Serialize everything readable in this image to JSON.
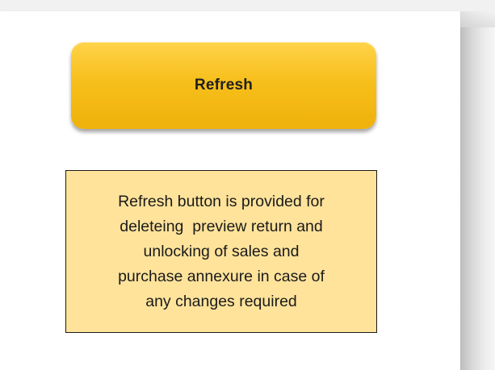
{
  "refresh_button": {
    "label": "Refresh",
    "color": "#f7bf1c"
  },
  "info_box": {
    "background": "#ffe39b",
    "lines": [
      "Refresh button is provided for",
      "deleteing  preview return and",
      "unlocking of sales and",
      "purchase annexure in case of",
      "any changes required"
    ]
  }
}
